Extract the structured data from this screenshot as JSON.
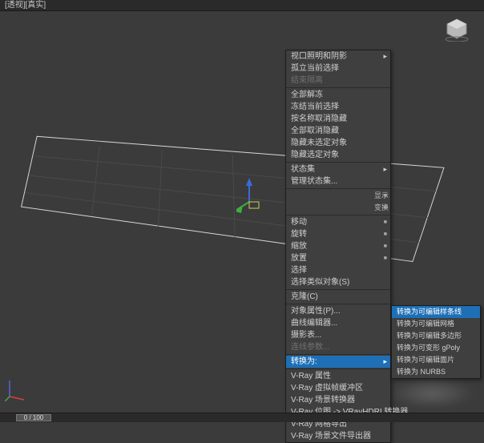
{
  "topbar": {
    "label": "[透视][真实]"
  },
  "timeline": {
    "pos": "0 / 100"
  },
  "menu": {
    "items": [
      {
        "label": "视口照明和阴影",
        "sub": true
      },
      {
        "label": "孤立当前选择"
      },
      {
        "label": "结束隔离",
        "disabled": true
      },
      {
        "sep": true
      },
      {
        "label": "全部解冻"
      },
      {
        "label": "冻结当前选择"
      },
      {
        "label": "按名称取消隐藏"
      },
      {
        "label": "全部取消隐藏"
      },
      {
        "label": "隐藏未选定对象"
      },
      {
        "label": "隐藏选定对象"
      },
      {
        "sep": true
      },
      {
        "label": "状态集",
        "sub": true
      },
      {
        "label": "管理状态集..."
      },
      {
        "sep": true
      },
      {
        "label": "",
        "side": "显示",
        "check": true
      },
      {
        "label": "",
        "side": "变换",
        "check": true
      },
      {
        "sep": true
      },
      {
        "label": "移动",
        "check": true
      },
      {
        "label": "旋转",
        "check": true
      },
      {
        "label": "缩放",
        "check": true
      },
      {
        "label": "放置",
        "check": true
      },
      {
        "label": "选择"
      },
      {
        "label": "选择类似对象(S)"
      },
      {
        "sep": true
      },
      {
        "label": "克隆(C)"
      },
      {
        "sep": true
      },
      {
        "label": "对象属性(P)..."
      },
      {
        "label": "曲线编辑器..."
      },
      {
        "label": "摄影表..."
      },
      {
        "label": "连线参数...",
        "disabled": true
      },
      {
        "sep": true
      },
      {
        "label": "转换为:",
        "sub": true,
        "hl": true
      },
      {
        "sep": true
      },
      {
        "label": "V-Ray 属性"
      },
      {
        "label": "V-Ray 虚拟帧缓冲区"
      },
      {
        "label": "V-Ray 场景转换器"
      },
      {
        "label": "V-Ray 位图 -> VRayHDRI 转换器"
      },
      {
        "label": "V-Ray 网格导出"
      },
      {
        "label": "V-Ray 场景文件导出器"
      }
    ]
  },
  "submenu": {
    "items": [
      {
        "label": "转换为可编辑样条线",
        "hl": true
      },
      {
        "label": "转换为可编辑网格"
      },
      {
        "label": "转换为可编辑多边形"
      },
      {
        "label": "转换为可变形 gPoly"
      },
      {
        "label": "转换为可编辑面片"
      },
      {
        "label": "转换为 NURBS"
      }
    ]
  }
}
